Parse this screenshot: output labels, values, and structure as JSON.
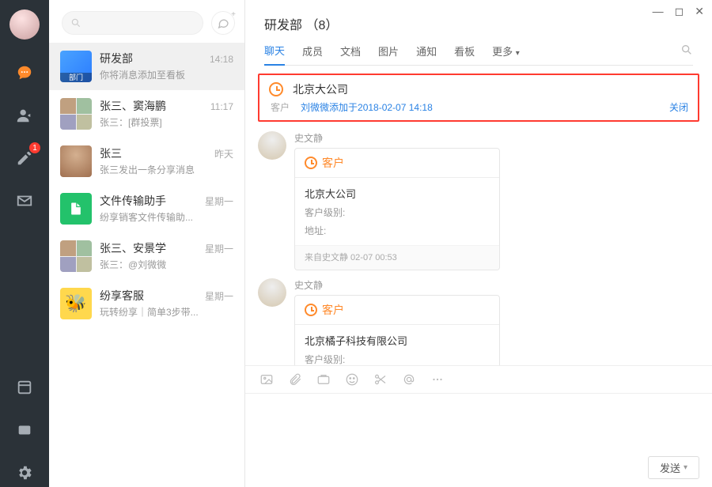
{
  "window": {
    "min": "—",
    "max": "◻",
    "close": "✕"
  },
  "rail": {
    "nav": [
      "chat",
      "contacts",
      "compose",
      "mail"
    ],
    "badge": "1",
    "bottom": [
      "window",
      "pin",
      "settings"
    ]
  },
  "search": {
    "placeholder": ""
  },
  "conversations": [
    {
      "name": "研发部",
      "sub": "你将消息添加至看板",
      "time": "14:18",
      "avatar": "dept",
      "dept_label": "部门",
      "selected": true
    },
    {
      "name": "张三、窦海鹏",
      "sub": "张三：[群投票]",
      "time": "11:17",
      "avatar": "multi"
    },
    {
      "name": "张三",
      "sub": "张三发出一条分享消息",
      "time": "昨天",
      "avatar": "single"
    },
    {
      "name": "文件传输助手",
      "sub": "纷享销客文件传输助...",
      "time": "星期一",
      "avatar": "file"
    },
    {
      "name": "张三、安景学",
      "sub": "张三：@刘微微",
      "time": "星期一",
      "avatar": "multi"
    },
    {
      "name": "纷享客服",
      "sub": "玩转纷享｜简单3步带...",
      "time": "星期一",
      "avatar": "bee"
    }
  ],
  "chat": {
    "title": "研发部 （8）",
    "tabs": [
      "聊天",
      "成员",
      "文档",
      "图片",
      "通知",
      "看板"
    ],
    "more": "更多",
    "active_tab": 0
  },
  "notice": {
    "title": "北京大公司",
    "tag": "客户",
    "desc": "刘微微添加于2018-02-07 14:18",
    "close": "关闭"
  },
  "messages": [
    {
      "sender": "史文静",
      "card_head": "客户",
      "company": "北京大公司",
      "level_label": "客户级别:",
      "addr_label": "地址:",
      "foot": "来自史文静 02-07 00:53"
    },
    {
      "sender": "史文静",
      "card_head": "客户",
      "company": "北京橘子科技有限公司",
      "level_label": "客户级别:",
      "addr_label": "",
      "foot": ""
    }
  ],
  "toolbar_icons": [
    "image",
    "attach",
    "card",
    "emoji",
    "cut",
    "at",
    "more"
  ],
  "send_label": "发送"
}
